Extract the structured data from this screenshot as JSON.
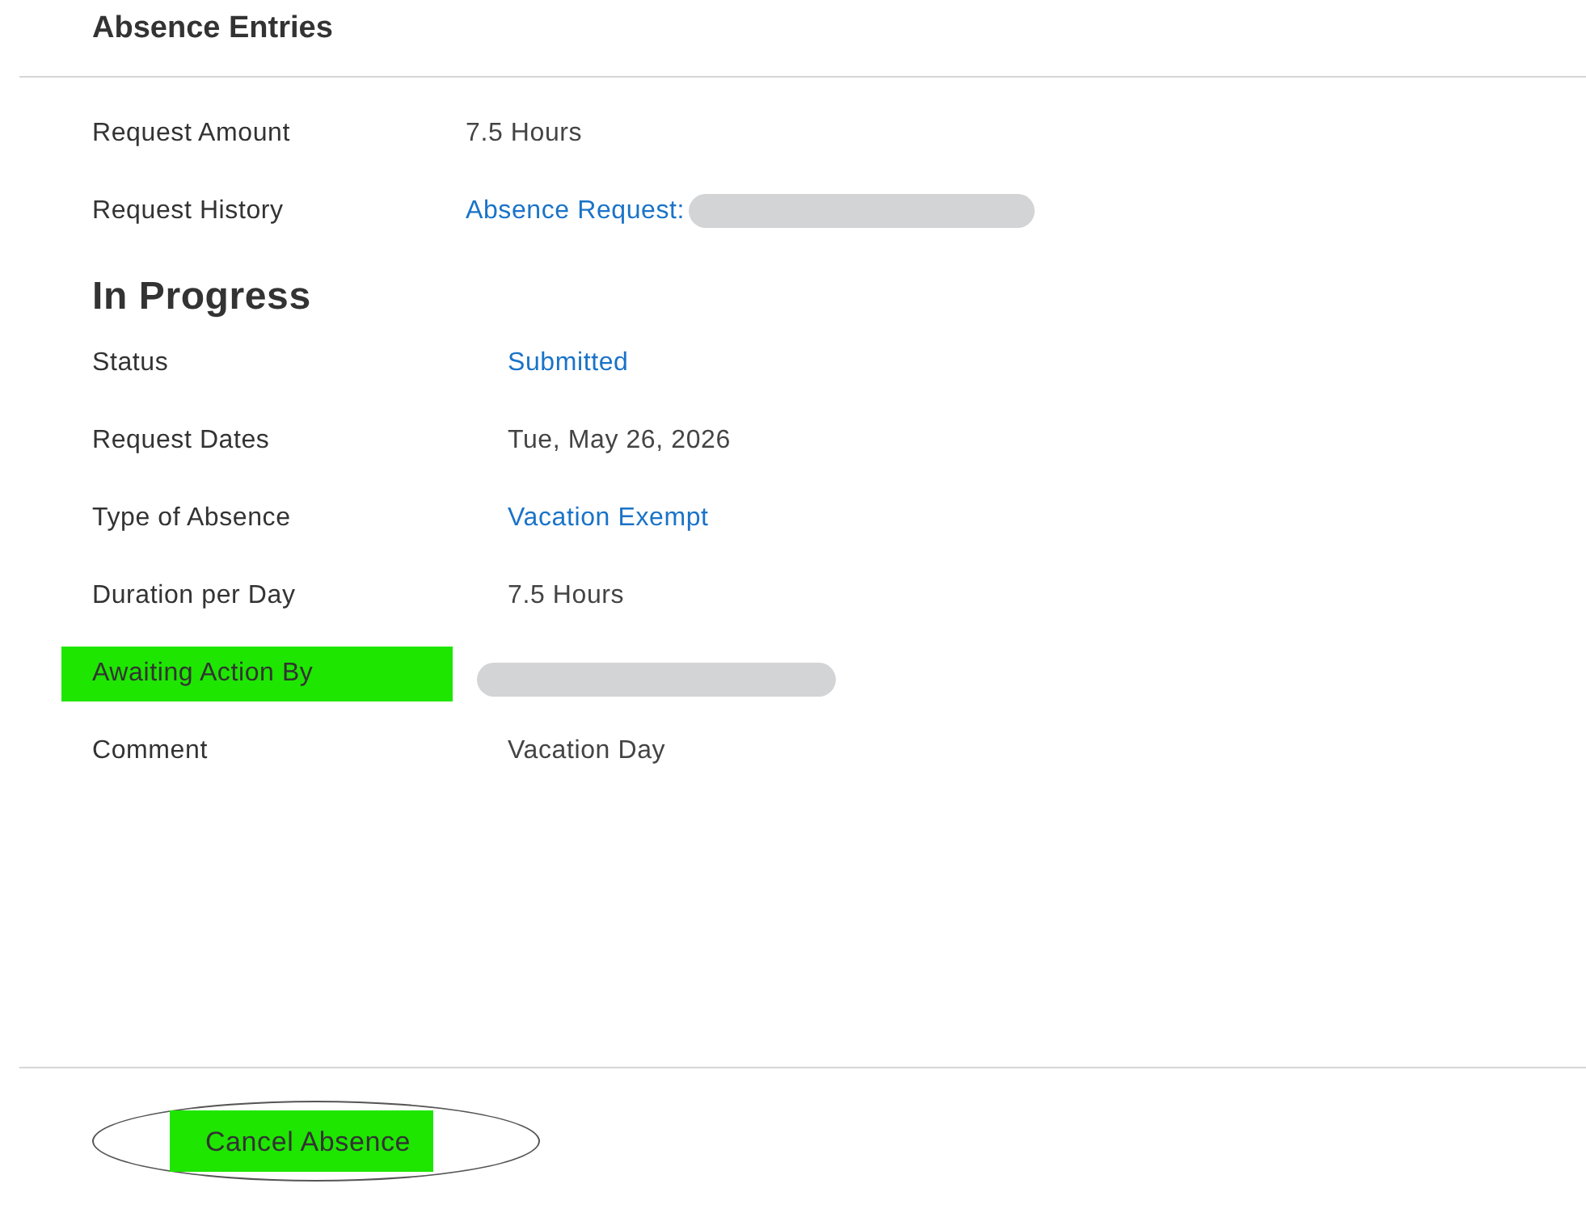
{
  "title": "Absence Entries",
  "summary": [
    {
      "label": "Request Amount",
      "value": "7.5 Hours",
      "kind": "text",
      "highlighted": false
    },
    {
      "label": "Request History",
      "value": "Absence Request:",
      "kind": "link",
      "redacted": true,
      "highlighted": false
    }
  ],
  "section": {
    "heading": "In Progress",
    "fields": [
      {
        "label": "Status",
        "value": "Submitted",
        "kind": "link",
        "highlighted": false
      },
      {
        "label": "Request Dates",
        "value": "Tue, May 26, 2026",
        "kind": "text",
        "highlighted": false
      },
      {
        "label": "Type of Absence",
        "value": "Vacation Exempt",
        "kind": "link",
        "highlighted": false
      },
      {
        "label": "Duration per Day",
        "value": "7.5 Hours",
        "kind": "text",
        "highlighted": false
      },
      {
        "label": "Awaiting Action By",
        "redacted": true,
        "highlighted": true
      },
      {
        "label": "Comment",
        "value": "Vacation Day",
        "kind": "text",
        "highlighted": false
      }
    ]
  },
  "button": {
    "label": "Cancel Absence",
    "highlighted": true
  }
}
